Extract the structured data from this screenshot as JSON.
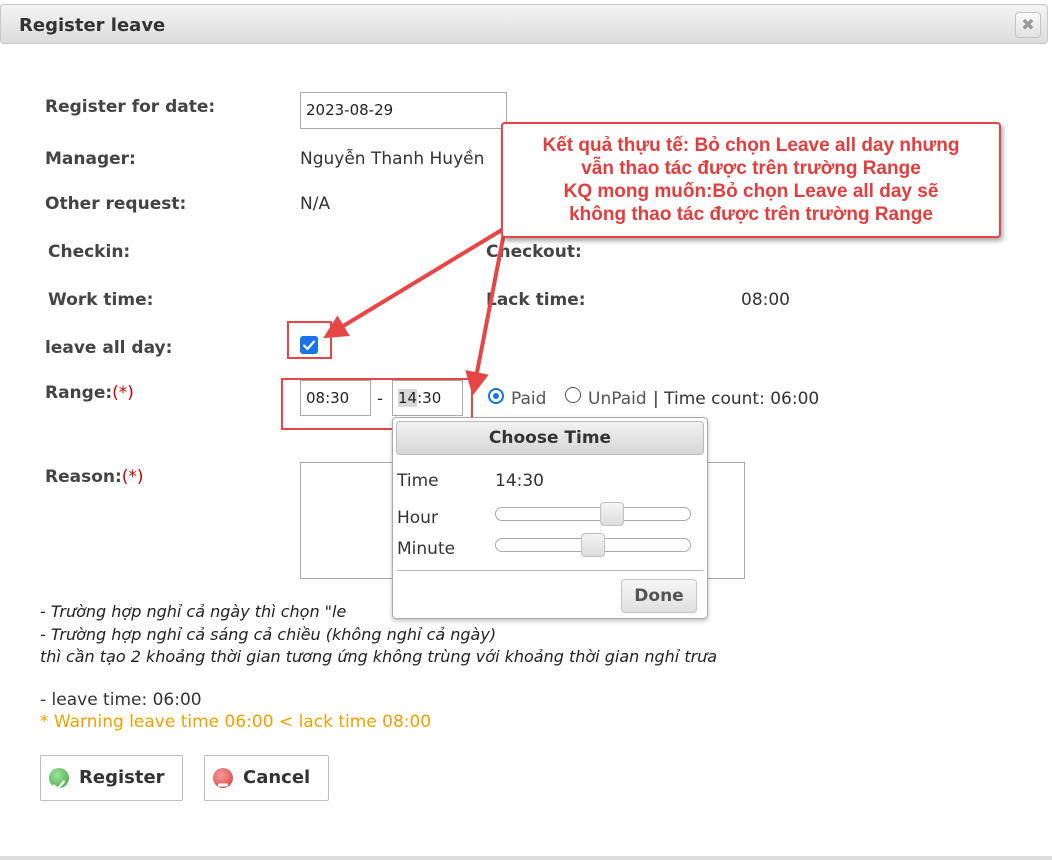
{
  "dialog": {
    "title": "Register leave",
    "close_icon": "✖"
  },
  "form": {
    "register_for_date": {
      "label": "Register for date:",
      "value": "2023-08-29"
    },
    "manager": {
      "label": "Manager:",
      "value": "Nguyễn Thanh Huyền"
    },
    "other_request": {
      "label": "Other request:",
      "value": "N/A"
    },
    "checkin": {
      "label": "Checkin:"
    },
    "checkout": {
      "label": "Checkout:"
    },
    "work_time": {
      "label": "Work time:"
    },
    "lack_time": {
      "label": "Lack time:",
      "value": "08:00"
    },
    "leave_all_day": {
      "label": "leave all day:",
      "checked": true
    },
    "range": {
      "label": "Range:",
      "required_mark": "(*)",
      "from": "08:30",
      "separator": "-",
      "to_prefix": "14",
      "to_suffix": ":30",
      "paid_label": "Paid",
      "unpaid_label": "UnPaid",
      "selected": "Paid",
      "time_count": "| Time count: 06:00"
    },
    "reason": {
      "label": "Reason:",
      "required_mark": "(*)"
    }
  },
  "time_picker": {
    "title": "Choose Time",
    "time_label": "Time",
    "time_value": "14:30",
    "hour_label": "Hour",
    "minute_label": "Minute",
    "hour_level": 0.6,
    "minute_level": 0.5,
    "done_label": "Done"
  },
  "notes": {
    "line1": "- Trường hợp nghỉ cả ngày thì chọn \"le",
    "line2": "- Trường hợp nghỉ cả sáng cả chiều (không nghỉ cả ngày)",
    "line3": "thì cần tạo 2 khoảng thời gian tương ứng không trùng với khoảng thời gian nghỉ trưa",
    "leave_time": "- leave time: 06:00",
    "warning": "* Warning leave time 06:00 < lack time 08:00"
  },
  "buttons": {
    "register_label": "Register",
    "cancel_label": "Cancel"
  },
  "annotation": {
    "line1": "Kết quả thựu tế: Bỏ chọn Leave all day nhưng",
    "line2": "vẫn thao tác  được trên trường Range",
    "line3": "KQ mong muốn:Bỏ chọn Leave all day sẽ",
    "line4": "không thao tác được trên trường Range"
  },
  "colors": {
    "annotation_red": "#e84646",
    "accent_blue": "#1a73e8",
    "warning_orange": "#f0a000",
    "required_red": "#d00000"
  }
}
